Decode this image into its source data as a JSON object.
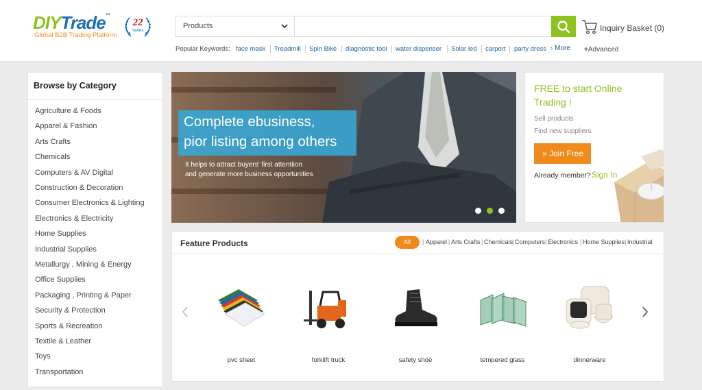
{
  "header": {
    "logo": {
      "part1": "DIY",
      "part2": "Trade",
      "tagline": "Global B2B Trading Platform",
      "badge_number": "22",
      "badge_text": "YEARS"
    },
    "search": {
      "category_selected": "Products",
      "placeholder": "",
      "button_icon": "search-icon"
    },
    "basket": {
      "label": "Inquiry Basket (0)",
      "icon": "cart-icon"
    },
    "keywords": {
      "label": "Popular Keywords:",
      "items": [
        "face mask",
        "Treadmill",
        "Spin Bike",
        "diagnostic tool",
        "water dispenser",
        "Solar led",
        "carport",
        "party dress"
      ],
      "more": "More",
      "advanced": "Advanced"
    }
  },
  "sidebar": {
    "title": "Browse by Category",
    "categories": [
      "Agriculture & Foods",
      "Apparel & Fashion",
      "Arts Crafts",
      "Chemicals",
      "Computers & AV Digital",
      "Construction & Decoration",
      "Consumer Electronics & Lighting",
      "Electronics & Electricity",
      "Home Supplies",
      "Industrial Supplies",
      "Metallurgy , Mining & Energy",
      "Office Supplies",
      "Packaging , Printing & Paper",
      "Security & Protection",
      "Sports & Recreation",
      "Textile & Leather",
      "Toys",
      "Transportation"
    ]
  },
  "banner": {
    "headline_line1": "Complete ebusiness,",
    "headline_line2": "pior listing among others",
    "sub_line1": "It helps to attract buyers' first attentiion",
    "sub_line2": "and generate more business opportunities",
    "slides": 3,
    "active_slide": 2
  },
  "join": {
    "title_line1": "FREE to start Online",
    "title_line2": "Trading !",
    "sell": "Sell products",
    "find": "Find new suppliers",
    "button": "» Join Free",
    "member_text": "Already member?",
    "signin": "Sign In"
  },
  "feature": {
    "title": "Feature Products",
    "filter_all": "All",
    "filters": [
      "Apparel",
      "Arts Crafts",
      "Chemicals",
      "Computers",
      "Electronics",
      "Home Supplies",
      "Industrial"
    ],
    "products": [
      "pvc sheet",
      "forklift truck",
      "safety shoe",
      "tempered glass",
      "dinnerware"
    ]
  },
  "colors": {
    "brand_green": "#8dc21f",
    "brand_orange": "#f08a1c",
    "brand_blue": "#1d6fb8",
    "banner_cyan": "#35a9d6"
  }
}
